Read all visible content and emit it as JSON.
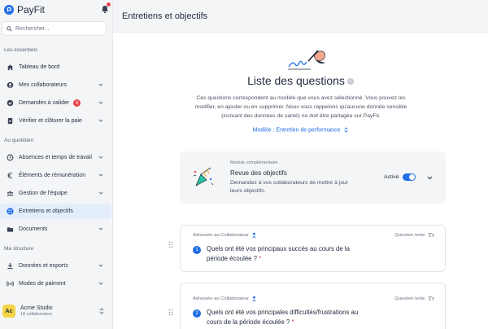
{
  "brand": {
    "name": "PayFit",
    "accent": "#1f6fe5"
  },
  "search": {
    "placeholder": "Rechercher..."
  },
  "sidebar": {
    "sections": {
      "essentials": "Les essentiels",
      "daily": "Au quotidien",
      "structure": "Ma structure"
    },
    "items": [
      {
        "label": "Tableau de bord",
        "icon": "home-icon",
        "has_chevron": false
      },
      {
        "label": "Mes collaborateurs",
        "icon": "user-circle-icon",
        "has_chevron": true
      },
      {
        "label": "Demandes à valider",
        "icon": "check-circle-icon",
        "has_chevron": true,
        "badge": "6"
      },
      {
        "label": "Vérifier et clôturer la paie",
        "icon": "document-check-icon",
        "has_chevron": true
      },
      {
        "label": "Absences et temps de travail",
        "icon": "clock-icon",
        "has_chevron": true
      },
      {
        "label": "Éléments de rémunération",
        "icon": "euro-icon",
        "has_chevron": true
      },
      {
        "label": "Gestion de l'équipe",
        "icon": "team-icon",
        "has_chevron": true
      },
      {
        "label": "Entretiens et objectifs",
        "icon": "grid-dots-icon",
        "has_chevron": false,
        "active": true
      },
      {
        "label": "Documents",
        "icon": "folder-icon",
        "has_chevron": true
      },
      {
        "label": "Données et exports",
        "icon": "download-icon",
        "has_chevron": true
      },
      {
        "label": "Modes de paiment",
        "icon": "radio-waves-icon",
        "has_chevron": true
      }
    ],
    "org": {
      "initials": "Ac",
      "name": "Acme Studio",
      "subtitle": "18 collaborators"
    }
  },
  "page": {
    "title": "Entretiens et objectifs",
    "heading": "Liste des questions",
    "heading_info": "i",
    "intro": "Ces questions correspondent au modèle que vous avez sélectionné. Vous pouvez les modifier, en ajouter ou en supprimer. Nous vous rappelons qu'aucune donnée sensible (incluant des données de santé) ne doit être partagée sur PayFit.",
    "model_selector": "Modèle : Entretien de performance"
  },
  "module": {
    "kicker": "Module complémentaire",
    "title": "Revue des objectifs",
    "description": "Demandez à vos collaborateurs de mettre à jour leurs objectifs.",
    "status_label": "Activé",
    "enabled": true
  },
  "questions": [
    {
      "addressee": "Adressée au Collaborateur",
      "type": "Question texte",
      "type_icon": "Tт",
      "number": "1",
      "text": "Quels ont été vos principaux succès au cours de la période écoulée ?",
      "required_mark": "*"
    },
    {
      "addressee": "Adressée au Collaborateur",
      "type": "Question texte",
      "type_icon": "Tт",
      "number": "2",
      "text": "Quels ont été vos principales difficultés/frustrations au cours de la période écoulée ?",
      "required_mark": "*"
    }
  ]
}
